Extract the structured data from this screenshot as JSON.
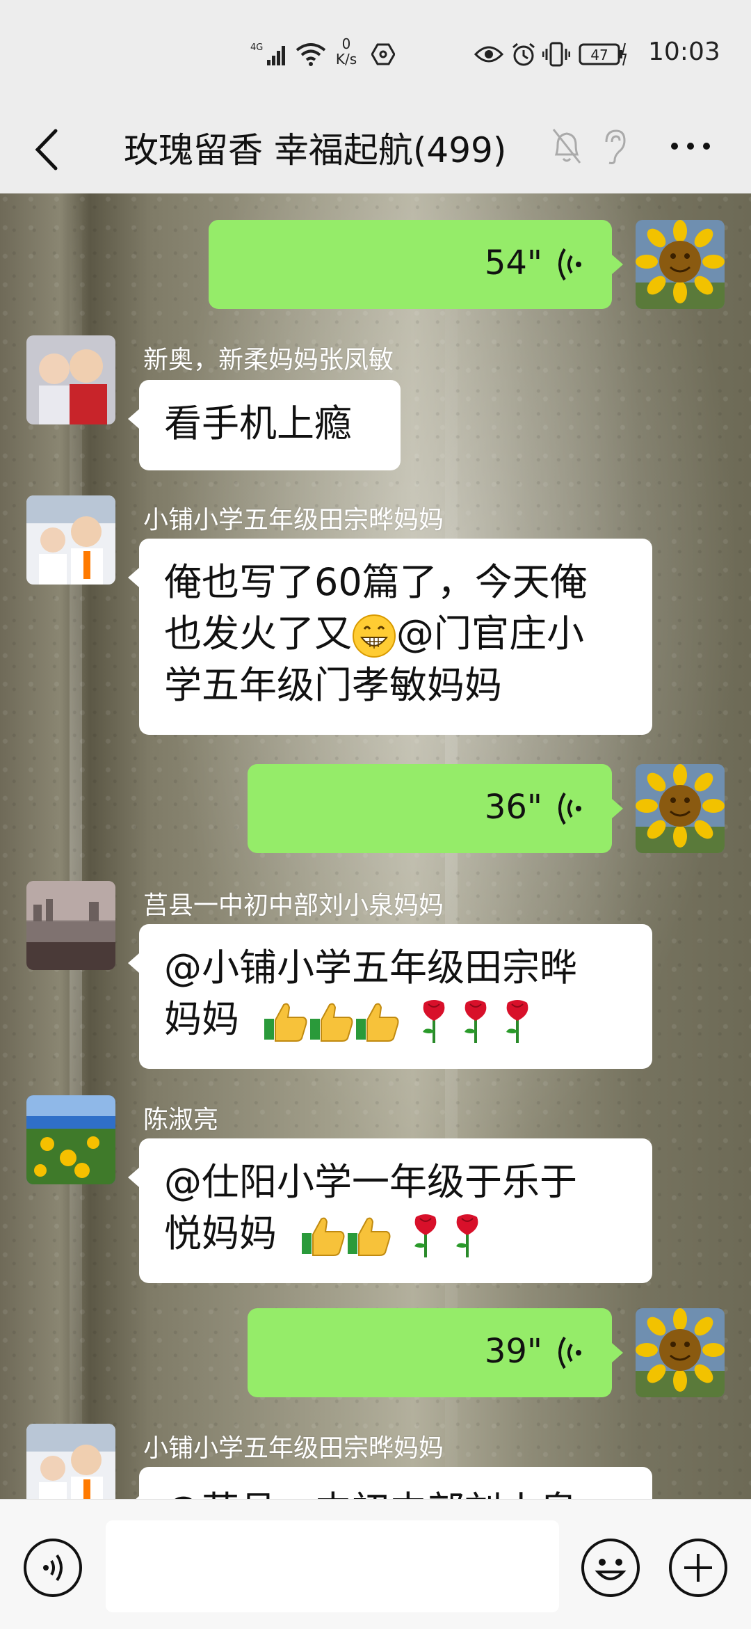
{
  "status_bar": {
    "network": "4G",
    "speed_value": "0",
    "speed_unit": "K/s",
    "battery": "47",
    "time": "10:03"
  },
  "header": {
    "title": "玫瑰留香  幸福起航(499)"
  },
  "messages": [
    {
      "type": "voice",
      "side": "self",
      "duration": "54\""
    },
    {
      "type": "text",
      "side": "other",
      "sender": "新奥，新柔妈妈张凤敏",
      "text": "看手机上瘾"
    },
    {
      "type": "text",
      "side": "other",
      "sender": "小铺小学五年级田宗晔妈妈",
      "line1": "俺也写了60篇了，今天俺",
      "line2_before": "也发火了又",
      "line2_after": "@门官庄小",
      "line3": "学五年级门孝敏妈妈"
    },
    {
      "type": "voice",
      "side": "self",
      "duration": "36\""
    },
    {
      "type": "text",
      "side": "other",
      "sender": "莒县一中初中部刘小泉妈妈",
      "line1": "@小铺小学五年级田宗晔",
      "line2": "妈妈"
    },
    {
      "type": "text",
      "side": "other",
      "sender": "陈淑亮",
      "line1": "@仕阳小学一年级于乐于",
      "line2": "悦妈妈"
    },
    {
      "type": "voice",
      "side": "self",
      "duration": "39\""
    },
    {
      "type": "text",
      "side": "other",
      "sender": "小铺小学五年级田宗晔妈妈",
      "text": "@莒县一中初中部刘小泉"
    }
  ],
  "colors": {
    "self_bubble": "#95ec69",
    "other_bubble": "#ffffff",
    "header_bg": "#ededed"
  },
  "icons": [
    "back-arrow-icon",
    "mute-bell-icon",
    "ear-icon",
    "more-dots-icon",
    "voice-wave-icon",
    "emoji-icon",
    "plus-icon",
    "thumbs-up-icon",
    "rose-icon",
    "grin-emoji-icon"
  ]
}
